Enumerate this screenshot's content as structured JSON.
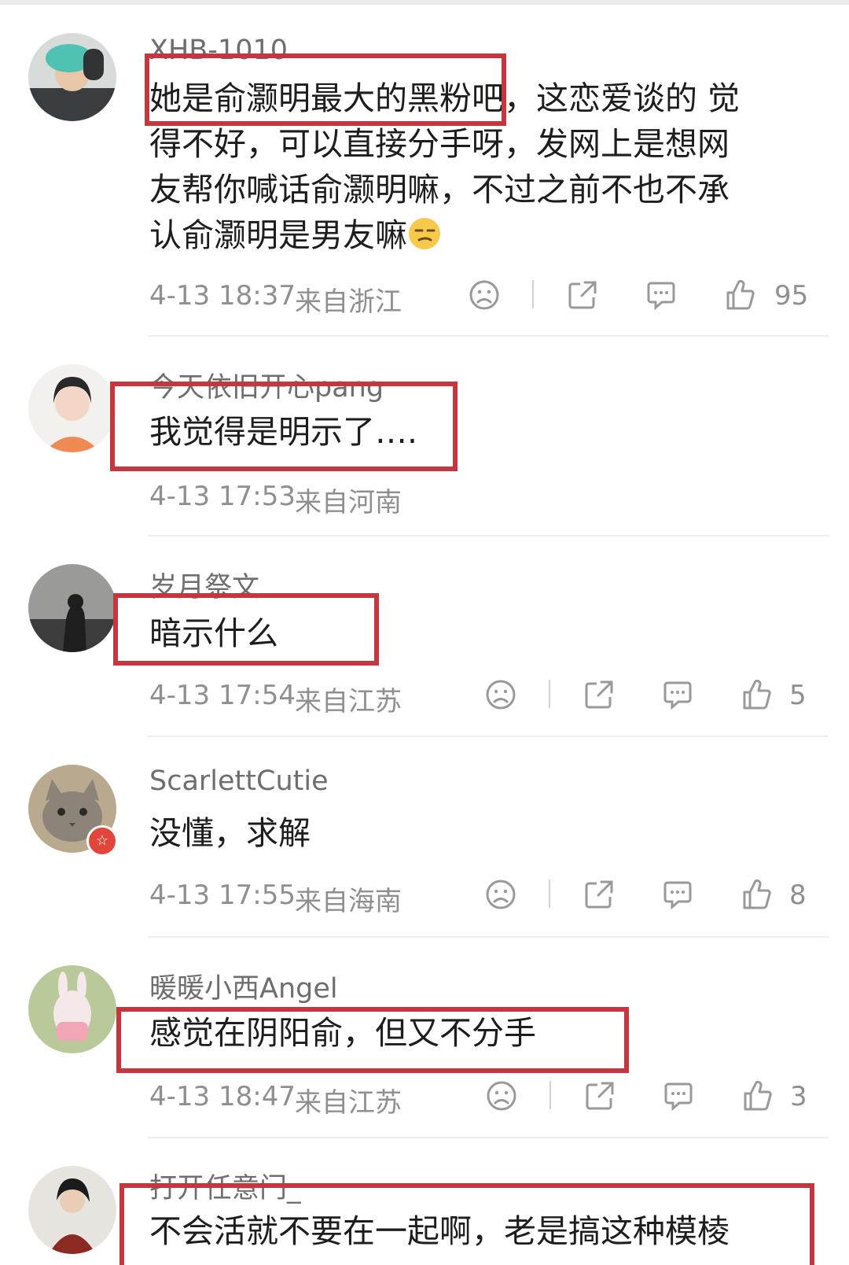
{
  "comments": [
    {
      "username": "XHB-1010",
      "lines": [
        "她是俞灏明最大的黑粉吧，这恋爱谈的 觉",
        "得不好，可以直接分手呀，发网上是想网",
        "友帮你喊话俞灏明嘛，不过之前不也不承",
        "认俞灏明是男友嘛"
      ],
      "time": "4-13 18:37",
      "location": "来自浙江",
      "likes": "95"
    },
    {
      "username": "今天依旧开心pang",
      "lines": [
        "我觉得是明示了…."
      ],
      "time": "4-13 17:53",
      "location": "来自河南",
      "likes": ""
    },
    {
      "username": "岁月祭文",
      "lines": [
        "暗示什么"
      ],
      "time": "4-13 17:54",
      "location": "来自江苏",
      "likes": "5"
    },
    {
      "username": "ScarlettCutie",
      "lines": [
        "没懂，求解"
      ],
      "time": "4-13 17:55",
      "location": "来自海南",
      "likes": "8"
    },
    {
      "username": "暖暖小西Angel",
      "lines": [
        "感觉在阴阳俞，但又不分手"
      ],
      "time": "4-13 18:47",
      "location": "来自江苏",
      "likes": "3"
    },
    {
      "username": "打开任意门_",
      "lines": [
        "不会活就不要在一起啊，老是搞这种模棱"
      ],
      "time": "",
      "location": "",
      "likes": ""
    }
  ],
  "icons": {
    "dislike": "sad-face-icon",
    "share": "share-icon",
    "comment": "comment-bubble-icon",
    "like": "thumbs-up-icon",
    "emoji": "smirk-emoji-icon"
  },
  "colors": {
    "highlight_box": "#c4373f",
    "meta_text": "#8f8f8f",
    "username": "#6e6e6e",
    "badge": "#e0473a"
  }
}
